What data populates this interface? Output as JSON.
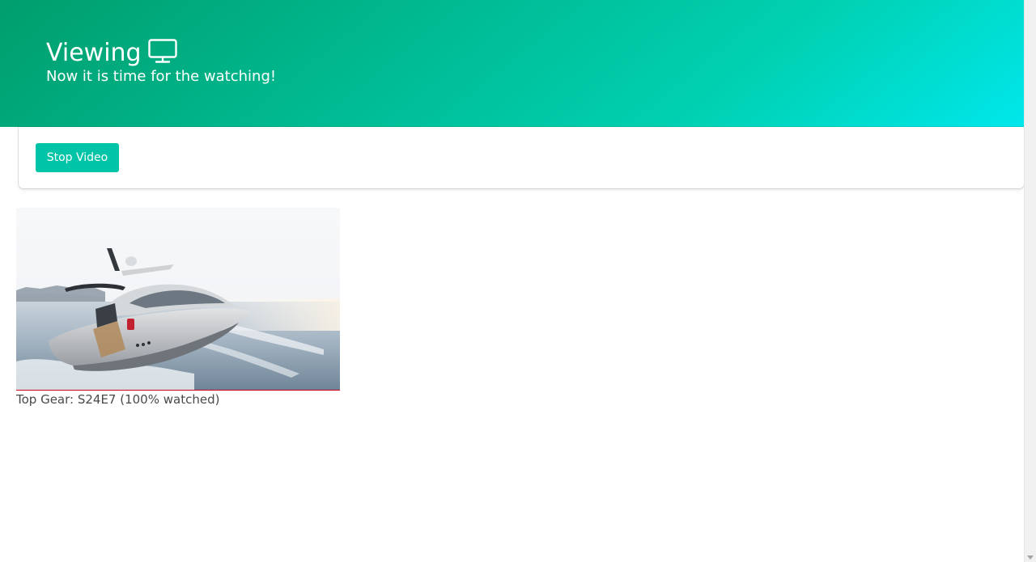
{
  "hero": {
    "title": "Viewing",
    "title_icon": "desktop-monitor-icon",
    "subtitle": "Now it is time for the watching!",
    "gradient_colors": [
      "#009e6c",
      "#00d1b2",
      "#00e7eb"
    ]
  },
  "controls": {
    "stop_label": "Stop Video",
    "button_color": "#00c4a7"
  },
  "video": {
    "thumbnail": "boat-yacht-thumbnail",
    "caption": "Top Gear: S24E7 (100% watched)",
    "progress_percent": 100,
    "progress_color": "#d0021b"
  }
}
